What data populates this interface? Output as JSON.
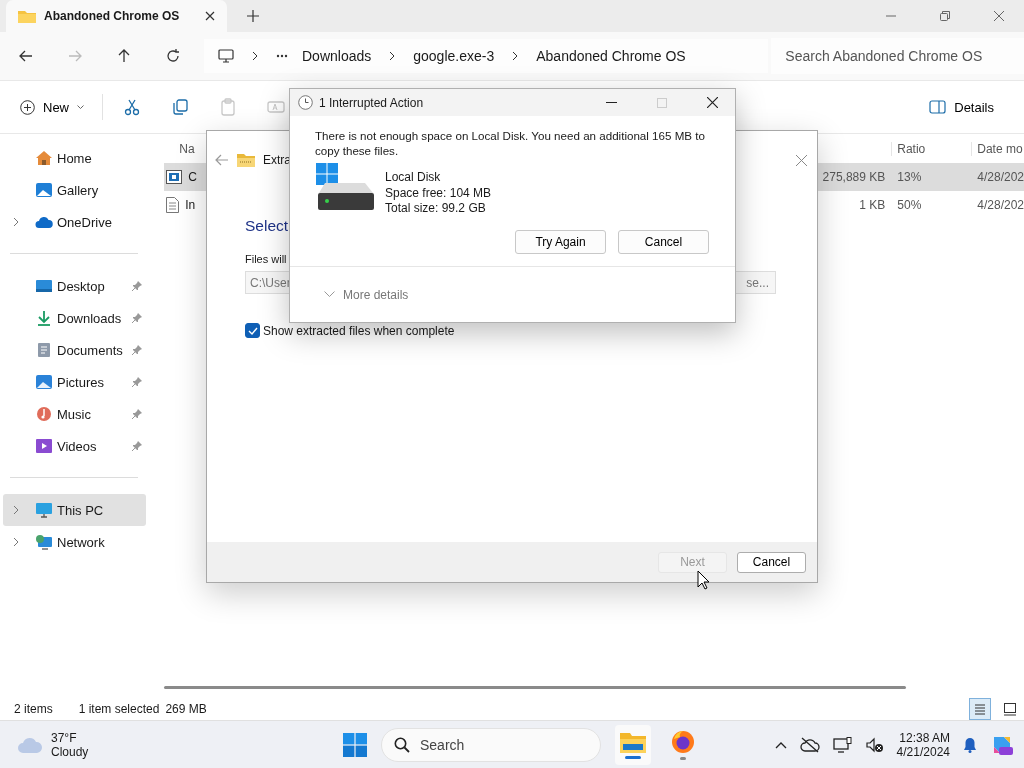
{
  "window": {
    "tab_title": "Abandoned Chrome OS"
  },
  "nav_buttons": [
    {
      "kind": "back",
      "disabled": false
    },
    {
      "kind": "forward",
      "disabled": true
    },
    {
      "kind": "up",
      "disabled": false
    },
    {
      "kind": "refresh",
      "disabled": false
    }
  ],
  "address_bar": {
    "breadcrumbs": [
      "Downloads",
      "google.exe-3",
      "Abandoned Chrome OS"
    ],
    "search": {
      "placeholder": "Search Abandoned Chrome OS"
    }
  },
  "toolbar": {
    "new_label": "New",
    "tools": [
      {
        "kind": "cut",
        "disabled": false
      },
      {
        "kind": "copy",
        "disabled": false
      },
      {
        "kind": "paste",
        "disabled": true
      },
      {
        "kind": "rename",
        "disabled": true
      }
    ],
    "details_label": "Details"
  },
  "sidebar": {
    "groups": [
      [
        {
          "label": "Home",
          "kind": "home",
          "expandable": false,
          "pinned": false,
          "selected": false
        },
        {
          "label": "Gallery",
          "kind": "gallery",
          "expandable": false,
          "pinned": false,
          "selected": false
        },
        {
          "label": "OneDrive",
          "kind": "cloud",
          "expandable": true,
          "pinned": false,
          "selected": false
        }
      ],
      [
        {
          "label": "Desktop",
          "kind": "desktop",
          "expandable": false,
          "pinned": true,
          "selected": false
        },
        {
          "label": "Downloads",
          "kind": "download",
          "expandable": false,
          "pinned": true,
          "selected": false
        },
        {
          "label": "Documents",
          "kind": "document",
          "expandable": false,
          "pinned": true,
          "selected": false
        },
        {
          "label": "Pictures",
          "kind": "pictures",
          "expandable": false,
          "pinned": true,
          "selected": false
        },
        {
          "label": "Music",
          "kind": "music",
          "expandable": false,
          "pinned": true,
          "selected": false
        },
        {
          "label": "Videos",
          "kind": "videos",
          "expandable": false,
          "pinned": true,
          "selected": false
        }
      ],
      [
        {
          "label": "This PC",
          "kind": "pc",
          "expandable": true,
          "pinned": false,
          "selected": true
        },
        {
          "label": "Network",
          "kind": "network",
          "expandable": true,
          "pinned": false,
          "selected": false
        }
      ]
    ]
  },
  "file_list": {
    "columns": [
      "Na",
      "Ratio",
      "Date mo"
    ],
    "rows": [
      {
        "name": "C",
        "kind": "archive",
        "size": "275,889 KB",
        "ratio": "13%",
        "date": "4/28/202",
        "selected": true
      },
      {
        "name": "In",
        "kind": "text",
        "size": "1 KB",
        "ratio": "50%",
        "date": "4/28/202",
        "selected": false
      }
    ]
  },
  "status_bar": {
    "item_count": "2 items",
    "selection": "1 item selected",
    "selection_size": "269 MB",
    "views": [
      {
        "kind": "details",
        "selected": true
      },
      {
        "kind": "tiles",
        "selected": false
      }
    ]
  },
  "wizard": {
    "location_label": "Extra",
    "heading": "Select",
    "destination_label": "Files will",
    "destination_value": "C:\\User",
    "browse_label": "se...",
    "show_files": {
      "label": "Show extracted files when complete",
      "checked": true
    },
    "buttons": [
      {
        "label": "Next",
        "disabled": true
      },
      {
        "label": "Cancel",
        "disabled": false
      }
    ]
  },
  "dialog": {
    "title": "1 Interrupted Action",
    "message": "There is not enough space on Local Disk. You need an additional 165 MB to copy these files.",
    "drive": {
      "name": "Local Disk",
      "free": "Space free: 104 MB",
      "total": "Total size: 99.2 GB"
    },
    "buttons": [
      {
        "label": "Try Again"
      },
      {
        "label": "Cancel"
      }
    ],
    "more_details": {
      "label": "More details",
      "expanded": false
    }
  },
  "taskbar": {
    "weather": {
      "temperature": "37°F",
      "condition": "Cloudy"
    },
    "search": {
      "placeholder": "Search"
    },
    "apps": [
      {
        "kind": "explorer",
        "active": true
      },
      {
        "kind": "firefox",
        "active": false
      }
    ],
    "clock": {
      "time": "12:38 AM",
      "date": "4/21/2024"
    }
  }
}
